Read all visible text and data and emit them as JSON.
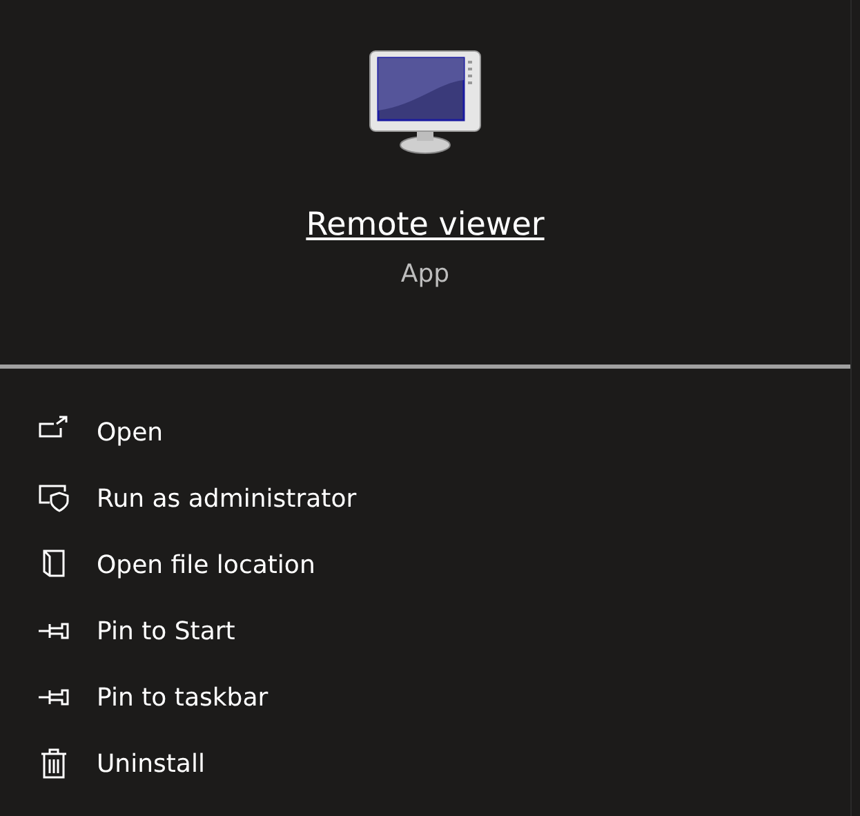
{
  "app": {
    "name": "Remote viewer",
    "type": "App"
  },
  "menu": [
    {
      "kind": "open",
      "label": "Open"
    },
    {
      "kind": "admin",
      "label": "Run as administrator"
    },
    {
      "kind": "folder",
      "label": "Open file location"
    },
    {
      "kind": "pin",
      "label": "Pin to Start"
    },
    {
      "kind": "pin",
      "label": "Pin to taskbar"
    },
    {
      "kind": "trash",
      "label": "Uninstall"
    }
  ]
}
